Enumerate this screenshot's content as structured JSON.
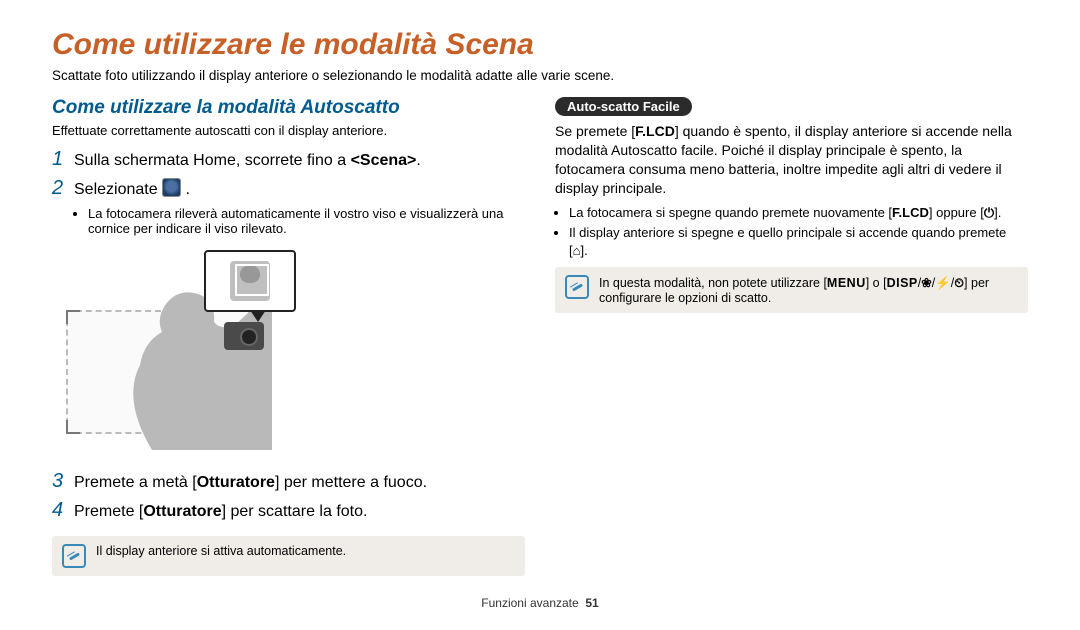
{
  "page_title": "Come utilizzare le modalità Scena",
  "subtitle": "Scattate foto utilizzando il display anteriore o selezionando le modalità adatte alle varie scene.",
  "left": {
    "section_title": "Come utilizzare la modalità Autoscatto",
    "section_desc": "Effettuate correttamente autoscatti con il display anteriore.",
    "step1_prefix": "Sulla schermata Home, scorrete fino a ",
    "step1_bold": "<Scena>",
    "step1_suffix": ".",
    "step2_prefix": "Selezionate ",
    "step2_suffix": ".",
    "step2_note": "La fotocamera rileverà automaticamente il vostro viso e visualizzerà una cornice per indicare il viso rilevato.",
    "step3_prefix": "Premete a metà [",
    "step3_bold": "Otturatore",
    "step3_suffix": "] per mettere a fuoco.",
    "step4_prefix": "Premete [",
    "step4_bold": "Otturatore",
    "step4_suffix": "] per scattare la foto.",
    "info": "Il display anteriore si attiva automaticamente."
  },
  "right": {
    "badge": "Auto-scatto Facile",
    "para_prefix": "Se premete [",
    "para_key1": "F.LCD",
    "para_mid": "] quando è spento, il display anteriore si accende nella modalità Autoscatto facile. Poiché il display principale è spento, la fotocamera consuma meno batteria, inoltre impedite agli altri di vedere il display principale.",
    "bullet1_prefix": "La fotocamera si spegne quando premete nuovamente [",
    "bullet1_key1": "F.LCD",
    "bullet1_mid": "] oppure [",
    "bullet1_sym": "⏻",
    "bullet1_suffix": "].",
    "bullet2_prefix": "Il display anteriore si spegne e quello principale si accende quando premete [",
    "bullet2_sym": "⌂",
    "bullet2_suffix": "].",
    "info_prefix": "In questa modalità, non potete utilizzare [",
    "info_menu": "MENU",
    "info_mid1": "] o [",
    "info_disp": "DISP",
    "info_mid2": "/",
    "info_sym_macro": "❀",
    "info_mid3": "/",
    "info_sym_flash": "⚡",
    "info_mid4": "/",
    "info_sym_timer": "⏲",
    "info_suffix": "] per configurare le opzioni di scatto."
  },
  "footer_label": "Funzioni avanzate",
  "footer_page": "51"
}
